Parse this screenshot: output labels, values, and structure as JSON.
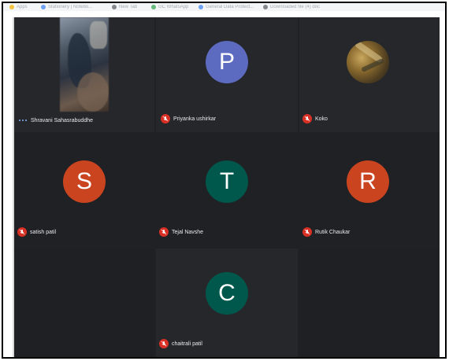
{
  "bookmarks": [
    {
      "label": "Apps",
      "color": "#f4b400"
    },
    {
      "label": "Stationery | Notebo...",
      "color": "#4285f4"
    },
    {
      "label": "New Tab",
      "color": "#5f6368"
    },
    {
      "label": "GC WhatsApp",
      "color": "#34a853"
    },
    {
      "label": "General Data Protect...",
      "color": "#4285f4"
    },
    {
      "label": "Downloaded file (4) doc",
      "color": "#5f6368"
    }
  ],
  "participants": [
    {
      "name": "Shravani Sahasrabuddhe",
      "type": "video",
      "speaking": true
    },
    {
      "name": "Priyanka ushirkar",
      "type": "initial",
      "initial": "P",
      "color": "#5c6bc0"
    },
    {
      "name": "Koko",
      "type": "photo"
    },
    {
      "name": "satish patil",
      "type": "initial",
      "initial": "S",
      "color": "#c9441f"
    },
    {
      "name": "Tejal Navshe",
      "type": "initial",
      "initial": "T",
      "color": "#00574b"
    },
    {
      "name": "Rutik Chaukar",
      "type": "initial",
      "initial": "R",
      "color": "#c9441f"
    },
    {
      "name": "chaitrali patil",
      "type": "initial",
      "initial": "C",
      "color": "#00574b"
    }
  ],
  "icons": {
    "muted": "mic-off-icon",
    "speaking": "speaking-indicator-icon"
  },
  "colors": {
    "background": "#202124",
    "tile": "#26272b",
    "muted_badge": "#d93025"
  }
}
